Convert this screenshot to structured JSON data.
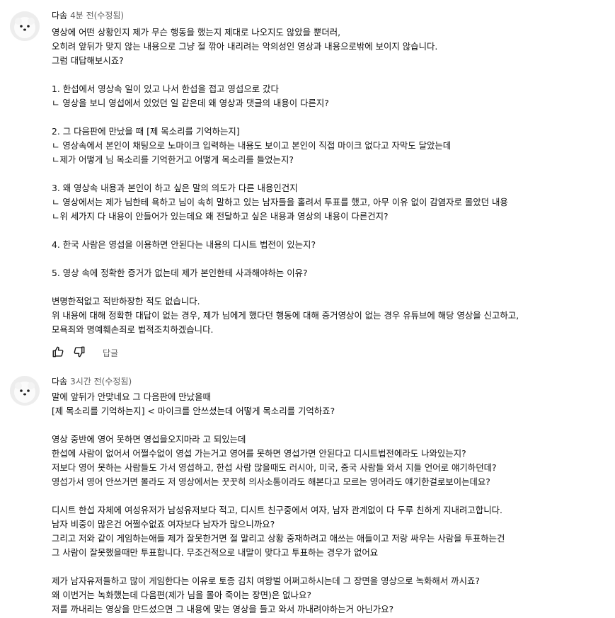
{
  "comments": [
    {
      "author": "다솜",
      "meta": "4분 전(수정됨)",
      "lines": [
        "영상에 어떤 상황인지 제가 무슨 행동을 했는지 제대로 나오지도 않았을 뿐더러,",
        "오히려 앞뒤가 맞지 않는 내용으로 그냥 절 깎아 내리려는 악의성인 영상과 내용으로밖에 보이지 않습니다.",
        "그럼 대답해보시죠?",
        "",
        "1. 한섭에서 영상속 일이 있고 나서 한섭을 접고 영섭으로 갔다",
        "ㄴ 영상을 보니 영섭에서 있었던 일 같은데 왜 영상과 댓글의 내용이 다른지?",
        "",
        "2. 그 다음판에 만났을 때 [제 목소리를 기억하는지]",
        "ㄴ 영상속에서 본인이 채팅으로 노마이크 입력하는 내용도 보이고 본인이 직접 마이크 없다고 자막도 달았는데",
        "ㄴ제가 어떻게 님 목소리를 기억한거고 어떻게 목소리를 들었는지?",
        "",
        "3. 왜 영상속 내용과 본인이 하고 싶은 말의 의도가 다른 내용인건지",
        "ㄴ 영상에서는 제가 님한테 욕하고 님이 속히 말하고 있는 남자들을 홀려서 투표를 했고, 아무 이유 없이 감염자로 몰았던 내용",
        "ㄴ위 세가지 다 내용이 안들어가 있는데요 왜 전달하고 싶은 내용과 영상의 내용이 다른건지?",
        "",
        "4. 한국 사람은 영섭을 이용하면 안된다는 내용의 디시트 법전이 있는지?",
        "",
        "5. 영상 속에 정확한 증거가 없는데 제가 본인한테 사과해야하는 이유?",
        "",
        "변명한적없고 적반하장한 적도 없습니다.",
        "위 내용에 대해 정확한 대답이 없는 경우, 제가 님에게 했다던 행동에 대해 증거영상이 없는 경우 유튜브에 해당 영상을 신고하고,",
        "모욕죄와 명예훼손죄로 법적조치하겠습니다."
      ],
      "reply_label": "답글"
    },
    {
      "author": "다솜",
      "meta": "3시간 전(수정됨)",
      "lines": [
        "말에 앞뒤가 안맞네요 그 다음판에 만났을때",
        "[제 목소리를 기억하는지] < 마이크를 안쓰셨는데 어떻게 목소리를 기억하죠?",
        "",
        "영상 중반에 영어 못하면 영섭을오지마라 고 되있는데",
        "한섭에 사람이 없어서 어쩔수없이 영섭 가는거고 영어를 못하면 영섭가면 안된다고 디시트법전에라도 나와있는지?",
        "저보다 영어 못하는 사람들도 가서 영섭하고, 한섭 사람 많을때도 러시아, 미국, 중국 사람들 와서 지들 언어로 얘기하던데?",
        "영섭가서 영어 안쓰거면 몰라도 저 영상에서는 꿋꿋히 의사소통이라도 해본다고 모르는 영어라도 얘기한걸로보이는데요?",
        "",
        "디시트 한섭 자체에 여성유저가 남성유저보다 적고, 디시트 친구중에서 여자, 남자 관계없이 다 두루 친하게 지내려고합니다.",
        "남자 비중이 많은건 어쩔수없죠 여자보다 남자가 많으니까요?",
        "그리고 저와 같이 게임하는애들 제가 잘못한거면 절 말리고 상황 중재하려고 애쓰는 애들이고 저랑 싸우는 사람을 투표하는건",
        "그 사람이 잘못했을때만 투표합니다. 무조건적으로 내말이 맞다고 투표하는 경우가 없어요",
        "",
        " 제가 남자유저들하고 많이 게임한다는 이유로 토종 김치 여왕벌  어쩌고하시는데 그 장면을 영상으로 녹화해서 까시죠?",
        " 왜 이번거는 녹화했는데 다음편(제가 님을 몰아 죽이는 장면)은  없나요?",
        "저를 까내리는 영상을 만드셨으면 그 내용에 맞는 영상을 들고 와서 까내려야하는거 아닌가요?"
      ]
    }
  ],
  "icons": [
    "pomeranian-avatar",
    "thumbs-up-icon",
    "thumbs-down-icon"
  ],
  "colors": {
    "text": "#0f0f0f",
    "meta": "#606060",
    "background": "#ffffff"
  }
}
